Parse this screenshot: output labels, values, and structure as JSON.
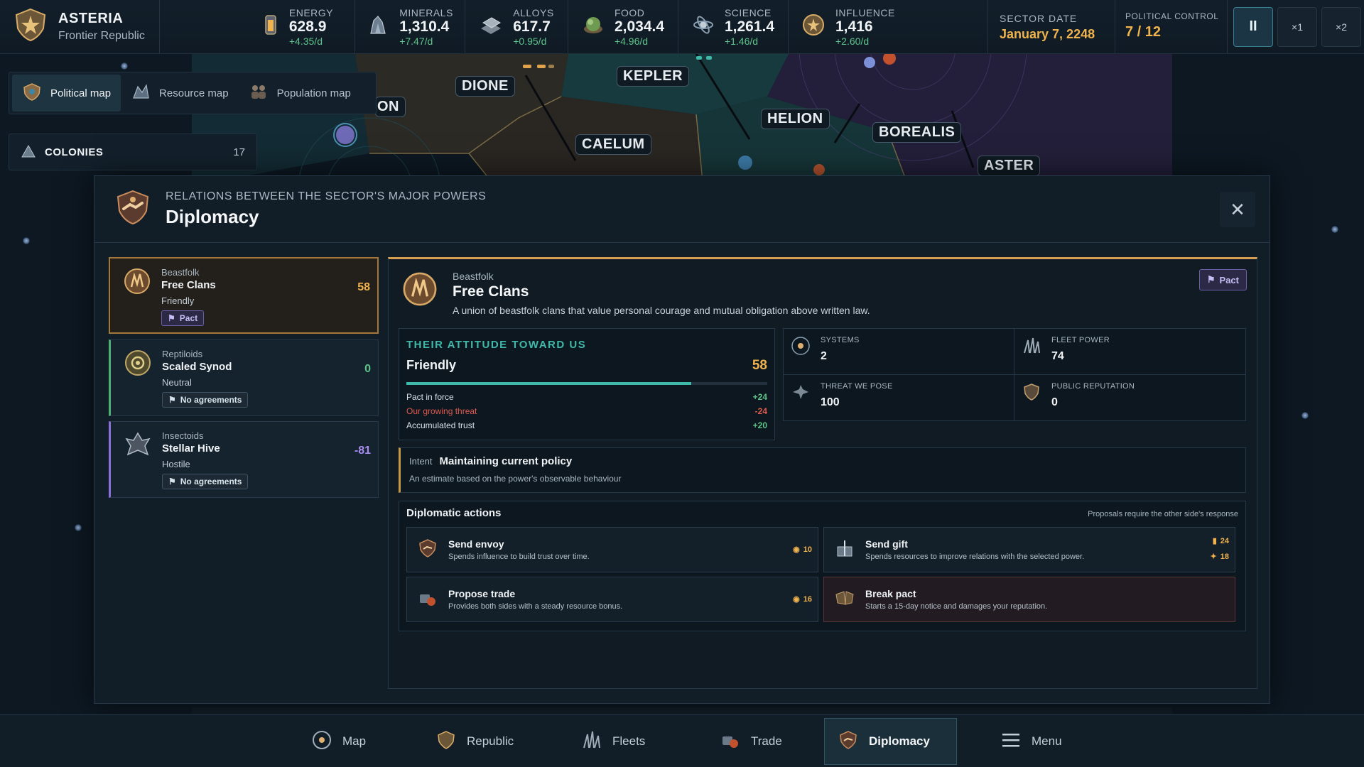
{
  "top": {
    "empire_name": "ASTERIA",
    "empire_sub": "Frontier Republic",
    "resources": [
      {
        "label": "ENERGY",
        "value": "628.9",
        "rate": "+4.35/d",
        "icon": "energy-icon"
      },
      {
        "label": "MINERALS",
        "value": "1,310.4",
        "rate": "+7.47/d",
        "icon": "minerals-icon"
      },
      {
        "label": "ALLOYS",
        "value": "617.7",
        "rate": "+0.95/d",
        "icon": "alloys-icon"
      },
      {
        "label": "FOOD",
        "value": "2,034.4",
        "rate": "+4.96/d",
        "icon": "food-icon"
      },
      {
        "label": "SCIENCE",
        "value": "1,261.4",
        "rate": "+1.46/d",
        "icon": "science-icon"
      },
      {
        "label": "INFLUENCE",
        "value": "1,416",
        "rate": "+2.60/d",
        "icon": "influence-icon"
      }
    ],
    "date_label": "SECTOR DATE",
    "date_value": "January 7, 2248",
    "control_label": "POLITICAL CONTROL",
    "control_value": "7 / 12",
    "speed": {
      "pause": "II",
      "x1": "×1",
      "x2": "×2"
    }
  },
  "map": {
    "tabs": [
      {
        "label": "Political map",
        "active": true
      },
      {
        "label": "Resource map",
        "active": false
      },
      {
        "label": "Population map",
        "active": false
      }
    ],
    "colonies_label": "COLONIES",
    "colonies_count": "17",
    "regions": [
      "ON",
      "DIONE",
      "KEPLER",
      "CAELUM",
      "HELION",
      "BOREALIS",
      "ASTER"
    ]
  },
  "panel": {
    "subtitle": "RELATIONS BETWEEN THE SECTOR'S MAJOR POWERS",
    "title": "Diplomacy",
    "factions": [
      {
        "race": "Beastfolk",
        "name": "Free Clans",
        "attitude": "Friendly",
        "score": "58",
        "chip": "Pact",
        "color": "#f0b34e"
      },
      {
        "race": "Reptiloids",
        "name": "Scaled Synod",
        "attitude": "Neutral",
        "score": "0",
        "chip": "No agreements",
        "color": "#5ec48a"
      },
      {
        "race": "Insectoids",
        "name": "Stellar Hive",
        "attitude": "Hostile",
        "score": "-81",
        "chip": "No agreements",
        "color": "#a88cf0"
      }
    ],
    "detail": {
      "race": "Beastfolk",
      "name": "Free Clans",
      "description": "A union of beastfolk clans that value personal courage and mutual obligation above written law.",
      "pact": "Pact",
      "attitude_heading": "THEIR ATTITUDE TOWARD US",
      "attitude_level": "Friendly",
      "attitude_score": "58",
      "attitude_fraction": 0.79,
      "modifiers": [
        {
          "label": "Pact in force",
          "value": "+24",
          "positive": true
        },
        {
          "label": "Our growing threat",
          "value": "-24",
          "positive": false
        },
        {
          "label": "Accumulated trust",
          "value": "+20",
          "positive": true
        }
      ],
      "stats": [
        {
          "label": "SYSTEMS",
          "value": "2",
          "icon": "systems-icon"
        },
        {
          "label": "FLEET POWER",
          "value": "74",
          "icon": "fleet-icon"
        },
        {
          "label": "THREAT WE POSE",
          "value": "100",
          "icon": "threat-icon"
        },
        {
          "label": "PUBLIC REPUTATION",
          "value": "0",
          "icon": "reputation-icon"
        }
      ],
      "intent_label": "Intent",
      "intent_value": "Maintaining current policy",
      "intent_note": "An estimate based on the power's observable behaviour",
      "actions_heading": "Diplomatic actions",
      "actions_note": "Proposals require the other side's response",
      "actions": [
        {
          "title": "Send envoy",
          "desc": "Spends influence to build trust over time.",
          "cost": "10"
        },
        {
          "title": "Send gift",
          "desc": "Spends resources to improve relations with the selected power.",
          "cost": "24",
          "cost2": "18"
        },
        {
          "title": "Propose trade",
          "desc": "Provides both sides with a steady resource bonus.",
          "cost": "16"
        },
        {
          "title": "Break pact",
          "desc": "Starts a 15-day notice and damages your reputation."
        }
      ]
    }
  },
  "bottom": {
    "tabs": [
      {
        "label": "Map"
      },
      {
        "label": "Republic"
      },
      {
        "label": "Fleets"
      },
      {
        "label": "Trade"
      },
      {
        "label": "Diplomacy",
        "active": true
      },
      {
        "label": "Menu"
      }
    ]
  }
}
